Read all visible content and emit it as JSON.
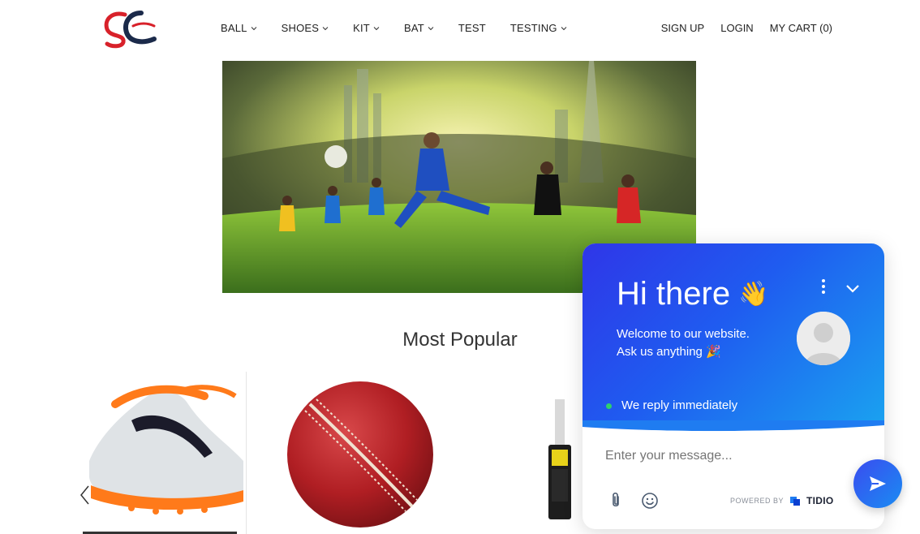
{
  "nav": {
    "items": [
      {
        "label": "BALL",
        "has_dropdown": true
      },
      {
        "label": "SHOES",
        "has_dropdown": true
      },
      {
        "label": "KIT",
        "has_dropdown": true
      },
      {
        "label": "BAT",
        "has_dropdown": true
      },
      {
        "label": "TEST",
        "has_dropdown": false
      },
      {
        "label": "TESTING",
        "has_dropdown": true
      }
    ],
    "signup": "SIGN UP",
    "login": "LOGIN",
    "cart": "MY CART (0)"
  },
  "section": {
    "title": "Most Popular"
  },
  "chat": {
    "greeting": "Hi there",
    "greeting_emoji": "👋",
    "welcome_line1": "Welcome to our website.",
    "welcome_line2": "Ask us anything",
    "welcome_emoji": "🎉",
    "status": "We reply immediately",
    "input_placeholder": "Enter your message...",
    "powered_by": "POWERED BY",
    "brand": "TIDIO"
  },
  "colors": {
    "chat_gradient_start": "#2f36e8",
    "chat_gradient_end": "#1aa3f0",
    "status_dot": "#2fd16b",
    "logo_red": "#d8212a",
    "logo_navy": "#1b2a4a"
  }
}
